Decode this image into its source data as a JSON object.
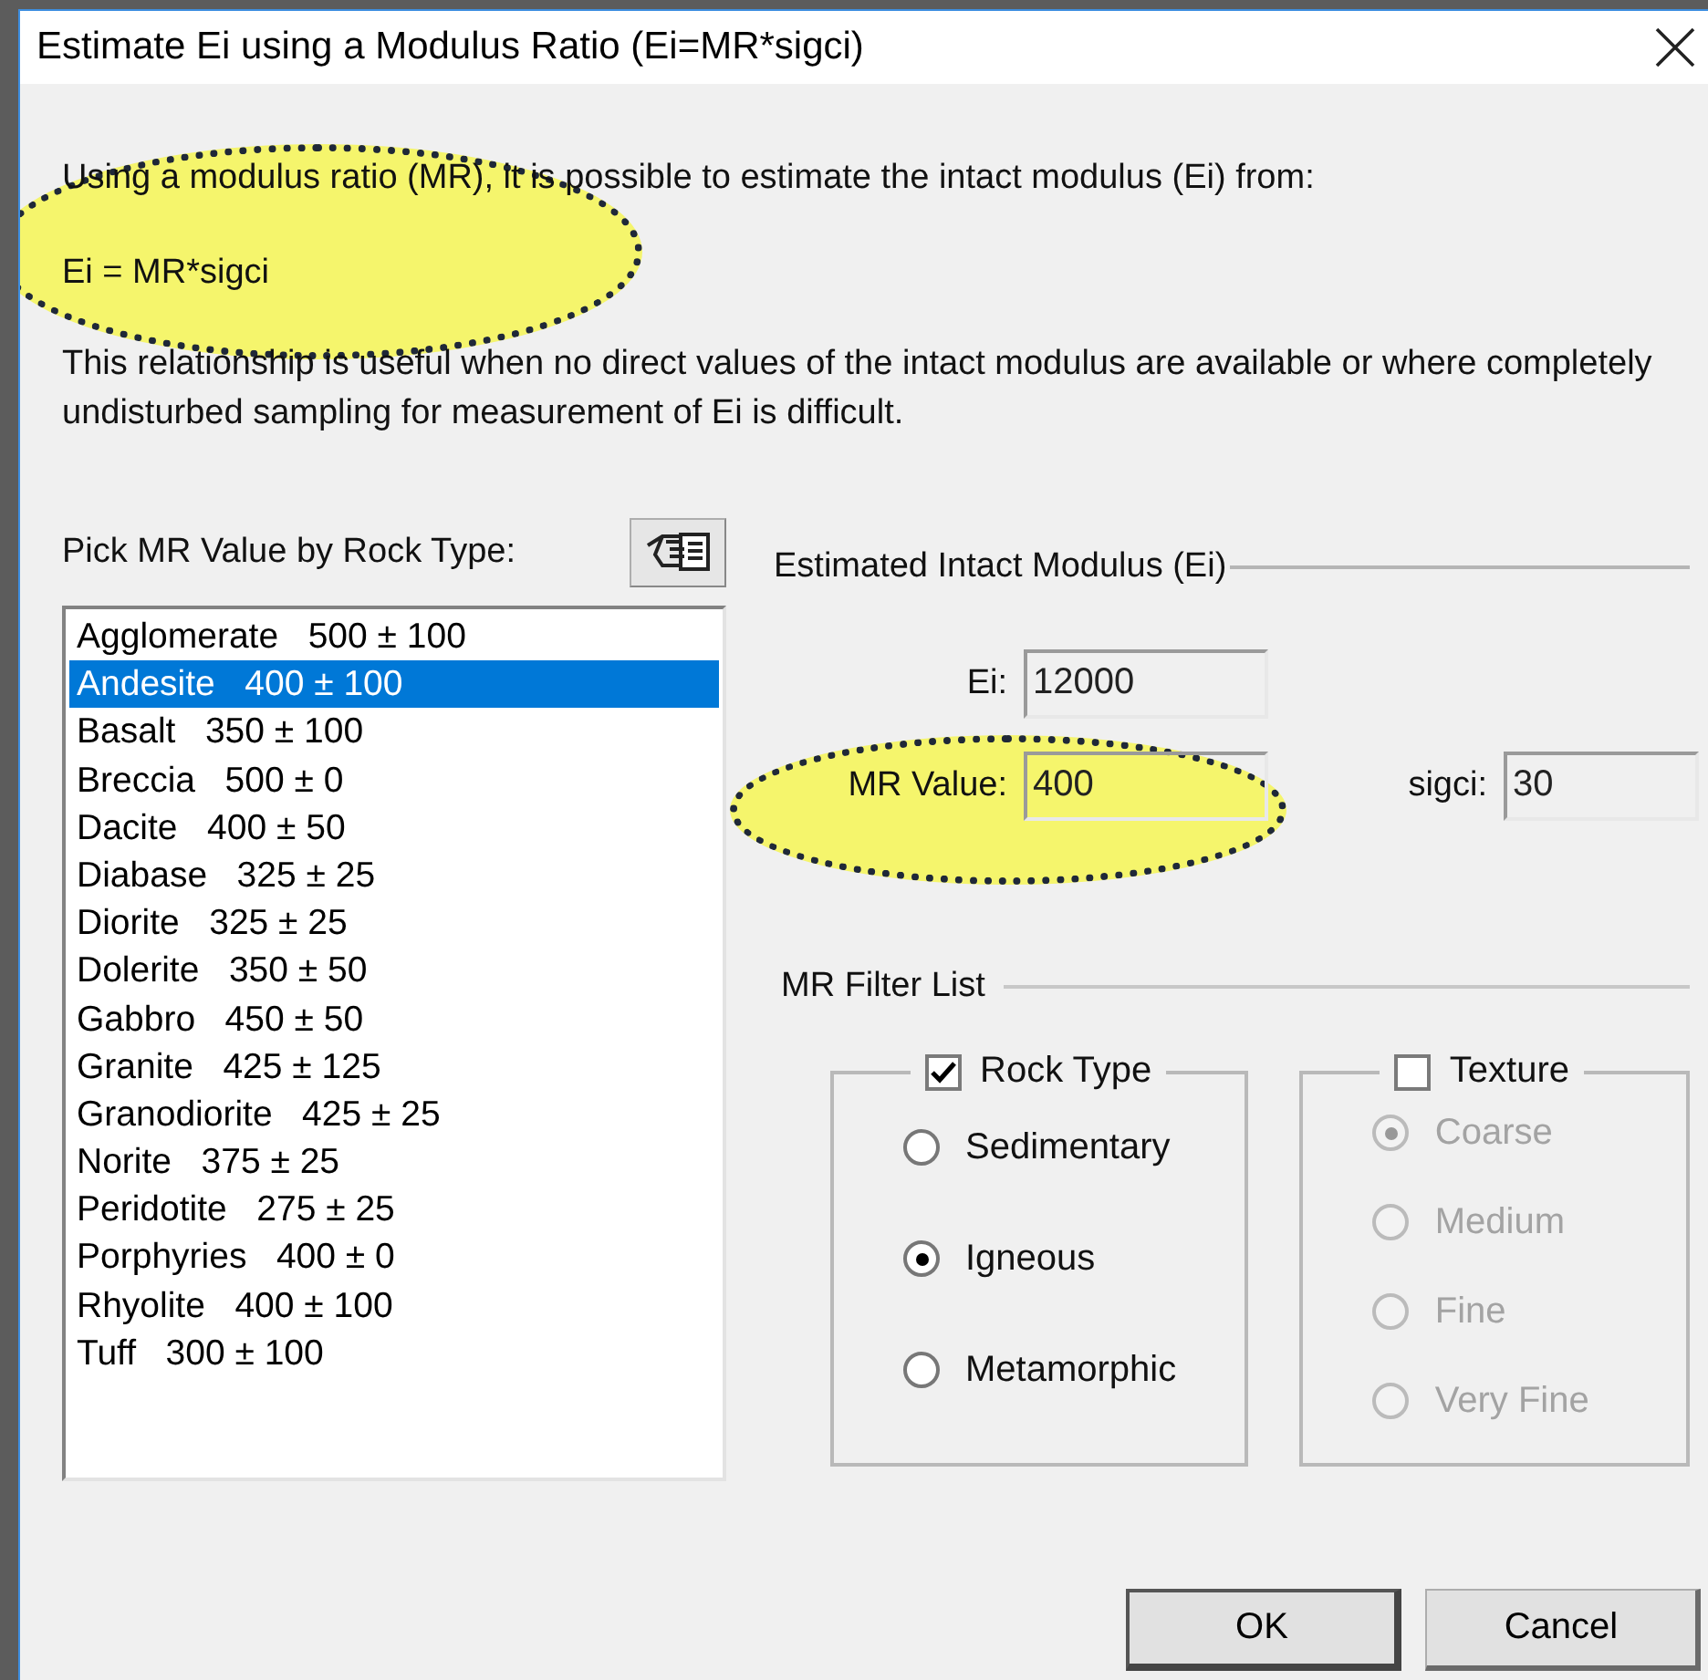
{
  "window": {
    "title": "Estimate Ei using a Modulus Ratio (Ei=MR*sigci)"
  },
  "intro": "Using a modulus ratio (MR), it is possible to estimate the intact modulus (Ei) from:",
  "formula": "Ei = MR*sigci",
  "note": "This relationship is useful when no direct values of the intact modulus are available or where completely undisturbed sampling for measurement of Ei is difficult.",
  "rock_list": {
    "label": "Pick MR Value by Rock Type:",
    "items": [
      {
        "text": "Agglomerate   500 ± 100",
        "selected": false
      },
      {
        "text": "Andesite   400 ± 100",
        "selected": true
      },
      {
        "text": "Basalt   350 ± 100",
        "selected": false
      },
      {
        "text": "Breccia   500 ± 0",
        "selected": false
      },
      {
        "text": "Dacite   400 ± 50",
        "selected": false
      },
      {
        "text": "Diabase   325 ± 25",
        "selected": false
      },
      {
        "text": "Diorite   325 ± 25",
        "selected": false
      },
      {
        "text": "Dolerite   350 ± 50",
        "selected": false
      },
      {
        "text": "Gabbro   450 ± 50",
        "selected": false
      },
      {
        "text": "Granite   425 ± 125",
        "selected": false
      },
      {
        "text": "Granodiorite   425 ± 25",
        "selected": false
      },
      {
        "text": "Norite   375 ± 25",
        "selected": false
      },
      {
        "text": "Peridotite   275 ± 25",
        "selected": false
      },
      {
        "text": "Porphyries   400 ± 0",
        "selected": false
      },
      {
        "text": "Rhyolite   400 ± 100",
        "selected": false
      },
      {
        "text": "Tuff   300 ± 100",
        "selected": false
      }
    ]
  },
  "modulus": {
    "heading": "Estimated Intact Modulus (Ei)",
    "ei": {
      "label": "Ei:",
      "value": "12000"
    },
    "mr": {
      "label": "MR Value:",
      "value": "400"
    },
    "sigci": {
      "label": "sigci:",
      "value": "30"
    }
  },
  "filter": {
    "heading": "MR Filter List",
    "groups": [
      {
        "label": "Rock Type",
        "checked": true,
        "options": [
          {
            "label": "Sedimentary",
            "selected": false,
            "disabled": false
          },
          {
            "label": "Igneous",
            "selected": true,
            "disabled": false
          },
          {
            "label": "Metamorphic",
            "selected": false,
            "disabled": false
          }
        ]
      },
      {
        "label": "Texture",
        "checked": false,
        "options": [
          {
            "label": "Coarse",
            "selected": true,
            "disabled": true
          },
          {
            "label": "Medium",
            "selected": false,
            "disabled": true
          },
          {
            "label": "Fine",
            "selected": false,
            "disabled": true
          },
          {
            "label": "Very Fine",
            "selected": false,
            "disabled": true
          }
        ]
      }
    ]
  },
  "buttons": [
    {
      "label": "OK",
      "default": true
    },
    {
      "label": "Cancel",
      "default": false
    }
  ]
}
